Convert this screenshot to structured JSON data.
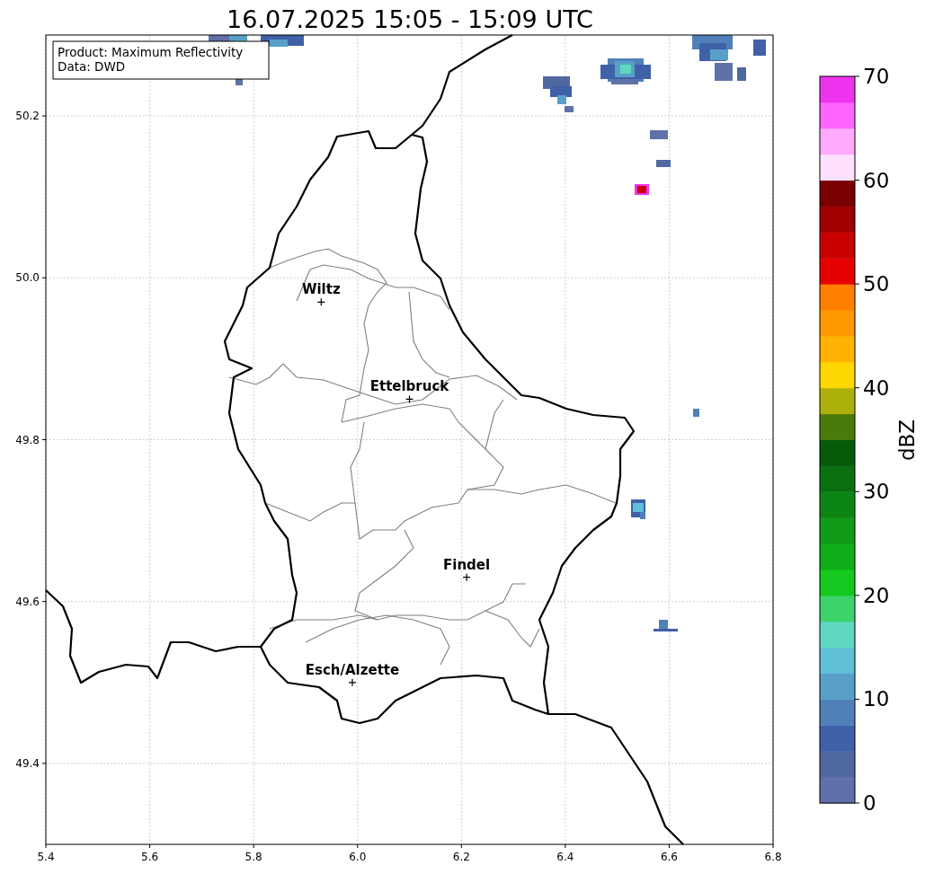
{
  "title": "16.07.2025 15:05 - 15:09 UTC",
  "info_box": [
    "Product: Maximum Reflectivity",
    "Data: DWD"
  ],
  "x_ticks": [
    "5.4",
    "5.6",
    "5.8",
    "6.0",
    "6.2",
    "6.4",
    "6.6",
    "6.8"
  ],
  "y_ticks": [
    "50.2",
    "50.0",
    "49.8",
    "49.6",
    "49.4"
  ],
  "cities": [
    {
      "name": "Wiltz"
    },
    {
      "name": "Ettelbruck"
    },
    {
      "name": "Findel"
    },
    {
      "name": "Esch/Alzette"
    }
  ],
  "colorbar": {
    "label": "dBZ",
    "ticks": [
      "70",
      "60",
      "50",
      "40",
      "30",
      "20",
      "10",
      "0"
    ]
  }
}
